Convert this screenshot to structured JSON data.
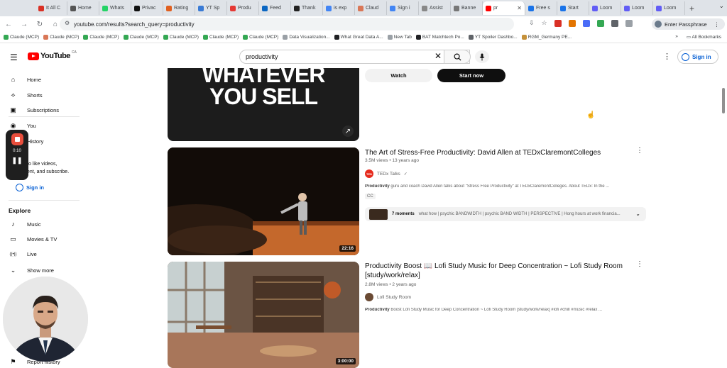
{
  "browser": {
    "tabs": [
      {
        "label": "It All C",
        "color": "#d93025"
      },
      {
        "label": "Home",
        "color": "#555555"
      },
      {
        "label": "Whats",
        "color": "#25d366"
      },
      {
        "label": "Privac",
        "color": "#111111"
      },
      {
        "label": "Rating",
        "color": "#e06020"
      },
      {
        "label": "YT Sp",
        "color": "#3a7bd5"
      },
      {
        "label": "Produ",
        "color": "#e53935"
      },
      {
        "label": "Feed",
        "color": "#0a66c2"
      },
      {
        "label": "Thank",
        "color": "#222222"
      },
      {
        "label": "is exp",
        "color": "#4285f4"
      },
      {
        "label": "Claud",
        "color": "#d97757"
      },
      {
        "label": "Sign i",
        "color": "#4285f4"
      },
      {
        "label": "Assist",
        "color": "#888888"
      },
      {
        "label": "Banne",
        "color": "#777777"
      },
      {
        "label": "pr",
        "color": "#ff0000",
        "active": true
      },
      {
        "label": "Free s",
        "color": "#1a73e8"
      },
      {
        "label": "Start",
        "color": "#1a73e8"
      },
      {
        "label": "Loom",
        "color": "#625df5"
      },
      {
        "label": "Loom",
        "color": "#625df5"
      },
      {
        "label": "Loom",
        "color": "#625df5"
      }
    ],
    "url": "youtube.com/results?search_query=productivity",
    "passphrase_label": "Enter Passphrase",
    "bookmarks": [
      "Claude (MCP)",
      "Claude (MCP)",
      "Claude (MCP)",
      "Claude (MCP)",
      "Claude (MCP)",
      "Claude (MCP)",
      "Claude (MCP)",
      "Data Visualization...",
      "What Great Data A...",
      "New Tab",
      "BAT Matchtech Po...",
      "YT Spoiler Dashbo...",
      "RGM_Germany PE..."
    ],
    "all_bookmarks": "All Bookmarks",
    "more_bookmarks": "»"
  },
  "yt": {
    "wordmark": "YouTube",
    "country": "CA",
    "search_value": "productivity",
    "sign_in": "Sign in"
  },
  "sidebar": {
    "items": [
      {
        "label": "Home",
        "icon": "⌂"
      },
      {
        "label": "Shorts",
        "icon": "⟡"
      },
      {
        "label": "Subscriptions",
        "icon": "▣"
      },
      {
        "label": "You",
        "icon": "◉"
      },
      {
        "label": "History",
        "icon": "↺"
      }
    ],
    "signin_text_1": "to like videos,",
    "signin_text_2": "ent, and subscribe.",
    "sign_in": "Sign in",
    "explore_heading": "Explore",
    "explore": [
      {
        "label": "Music",
        "icon": "♪"
      },
      {
        "label": "Movies & TV",
        "icon": "▭"
      },
      {
        "label": "Live",
        "icon": "((•))"
      },
      {
        "label": "Show more",
        "icon": "⌄"
      }
    ],
    "bottom_item": "Report history",
    "recorder_time": "0:10"
  },
  "results": {
    "ad": {
      "thumb_line1": "WHATEVER",
      "thumb_line2": "YOU SELL",
      "watch": "Watch",
      "start": "Start now"
    },
    "videos": [
      {
        "title": "The Art of Stress-Free Productivity: David Allen at TEDxClaremontColleges",
        "meta": "3.5M views • 13 years ago",
        "channel": "TEDx Talks",
        "verified": "✓",
        "desc_bold": "Productivity",
        "desc": " guru and coach David Allen talks about \"Stress Free Productivity\" at TEDxClaremontColleges. About TEDx: In the ...",
        "badge": "CC",
        "duration": "22:16",
        "moments_count": "7 moments",
        "moments_text": "what how | psychic BANDWIDTH | psychic BAND WIDTH | PERSPECTIVE | Hong hours at work financia..."
      },
      {
        "title": "Productivity Boost 📖 Lofi Study Music for Deep Concentration ~ Lofi Study Room [study/work/relax]",
        "meta": "2.8M views • 2 years ago",
        "channel": "Lofi Study Room",
        "desc_bold": "Productivity",
        "desc": " Boost Lofi Study Music for Deep Concentration ~ Lofi Study Room [study/work/relax] #lofi #chill #music #relax ...",
        "duration": "3:00:00"
      }
    ]
  }
}
